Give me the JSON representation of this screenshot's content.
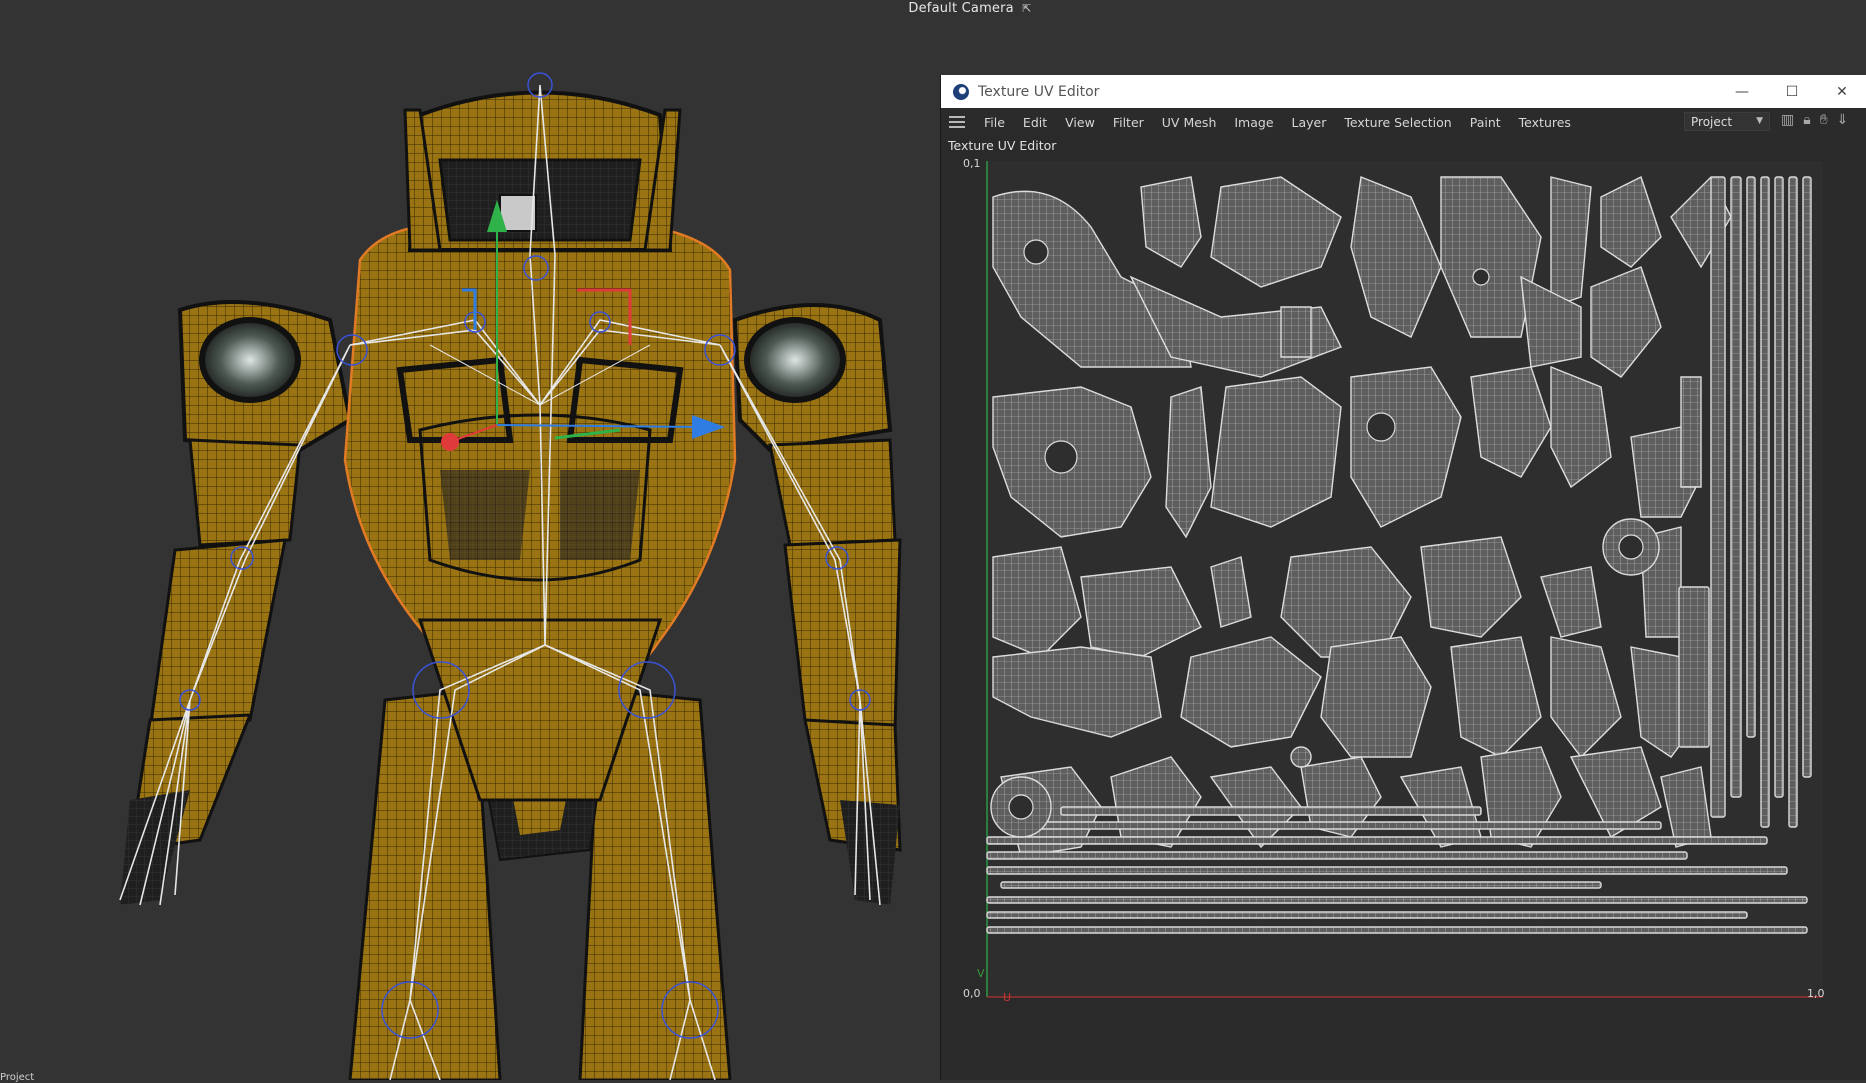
{
  "viewport": {
    "camera_label": "Default Camera",
    "camera_icon": "camera-switch-icon",
    "bottom_label": "Project"
  },
  "uv_editor": {
    "window_title": "Texture UV Editor",
    "window_controls": {
      "minimize": "—",
      "maximize": "☐",
      "close": "✕"
    },
    "menu": [
      "File",
      "Edit",
      "View",
      "Filter",
      "UV Mesh",
      "Image",
      "Layer",
      "Texture Selection",
      "Paint",
      "Textures"
    ],
    "project_select": "Project",
    "toolbar_icons": [
      "chart-icon",
      "lock-icon",
      "hand-icon",
      "pin-icon"
    ],
    "panel_title": "Texture UV Editor",
    "axis": {
      "top_left": "0,1",
      "bottom_left": "0,0",
      "bottom_right": "1,0",
      "u": "U",
      "v": "V"
    }
  },
  "colors": {
    "viewport_bg": "#333333",
    "armor": "#9a7412",
    "wire": "#3a2a05",
    "bone": "#e6e6e6",
    "uv_island": "#5e5e5e",
    "uv_edge": "#d0d0d0",
    "axis_green": "#2fb24a",
    "axis_red": "#e03b3b",
    "axis_blue": "#2f7ce3",
    "selection_orange": "#e07a24"
  }
}
